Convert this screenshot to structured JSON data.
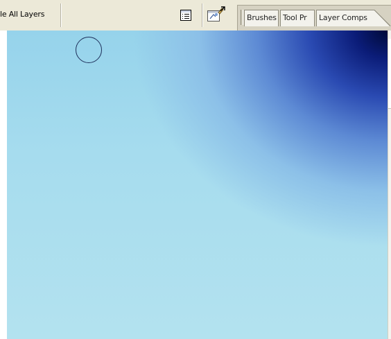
{
  "options_bar": {
    "sample_all_layers_label": "le All Layers",
    "palette_toggle_icon": "palette-toggle-icon",
    "tool_preset_icon": "tool-preset-picker-icon"
  },
  "palette_well": {
    "tabs": [
      {
        "label": "Brushes"
      },
      {
        "label": "Tool Pr"
      },
      {
        "label": "Layer Comps"
      }
    ]
  },
  "canvas": {
    "gradient_colors": [
      "#001040",
      "#2a4ab2",
      "#8cc0e8",
      "#b3e2ef"
    ],
    "cursor": "brush-circle-cursor"
  },
  "colors": {
    "chrome": "#ece9d8",
    "tab_bg": "#f3f2ec",
    "tab_border": "#8f8c7d"
  }
}
